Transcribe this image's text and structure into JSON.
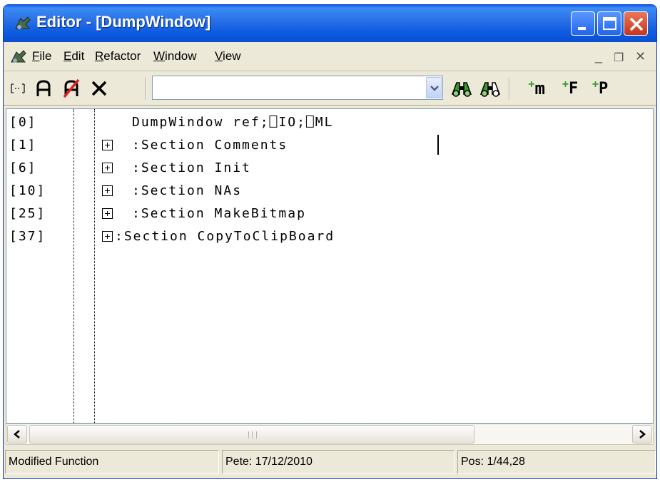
{
  "window": {
    "title": "Editor - [DumpWindow]"
  },
  "menubar": {
    "items": [
      "File",
      "Edit",
      "Refactor",
      "Window",
      "View"
    ],
    "underline": [
      "F",
      "E",
      "R",
      "W",
      "V"
    ]
  },
  "toolbar": {
    "search_value": "",
    "method_label": "m",
    "field_label": "F",
    "property_label": "P"
  },
  "editor": {
    "rows": [
      {
        "line": "[0]",
        "text": "DumpWindow ref;⎕IO;⎕ML",
        "expander": false
      },
      {
        "line": "[1]",
        "text": ":Section Comments",
        "expander": true
      },
      {
        "line": "[6]",
        "text": ":Section Init",
        "expander": true
      },
      {
        "line": "[10]",
        "text": ":Section NAs",
        "expander": true
      },
      {
        "line": "[25]",
        "text": ":Section MakeBitmap",
        "expander": true
      },
      {
        "line": "[37]",
        "text": ":Section CopyToClipBoard",
        "expander": true
      }
    ]
  },
  "statusbar": {
    "state": "Modified Function",
    "author": "Pete: 17/12/2010",
    "position": "Pos: 1/44,28"
  },
  "icons": {
    "app": "dyalog-app-icon",
    "outline": "outline-icon",
    "binoculars": "binoculars-icon"
  },
  "colors": {
    "titlebar": "#0c5ae0",
    "close": "#c8351c",
    "chrome": "#ece9d8",
    "find_green": "#3a9a2a",
    "delete_red": "#e02020"
  }
}
